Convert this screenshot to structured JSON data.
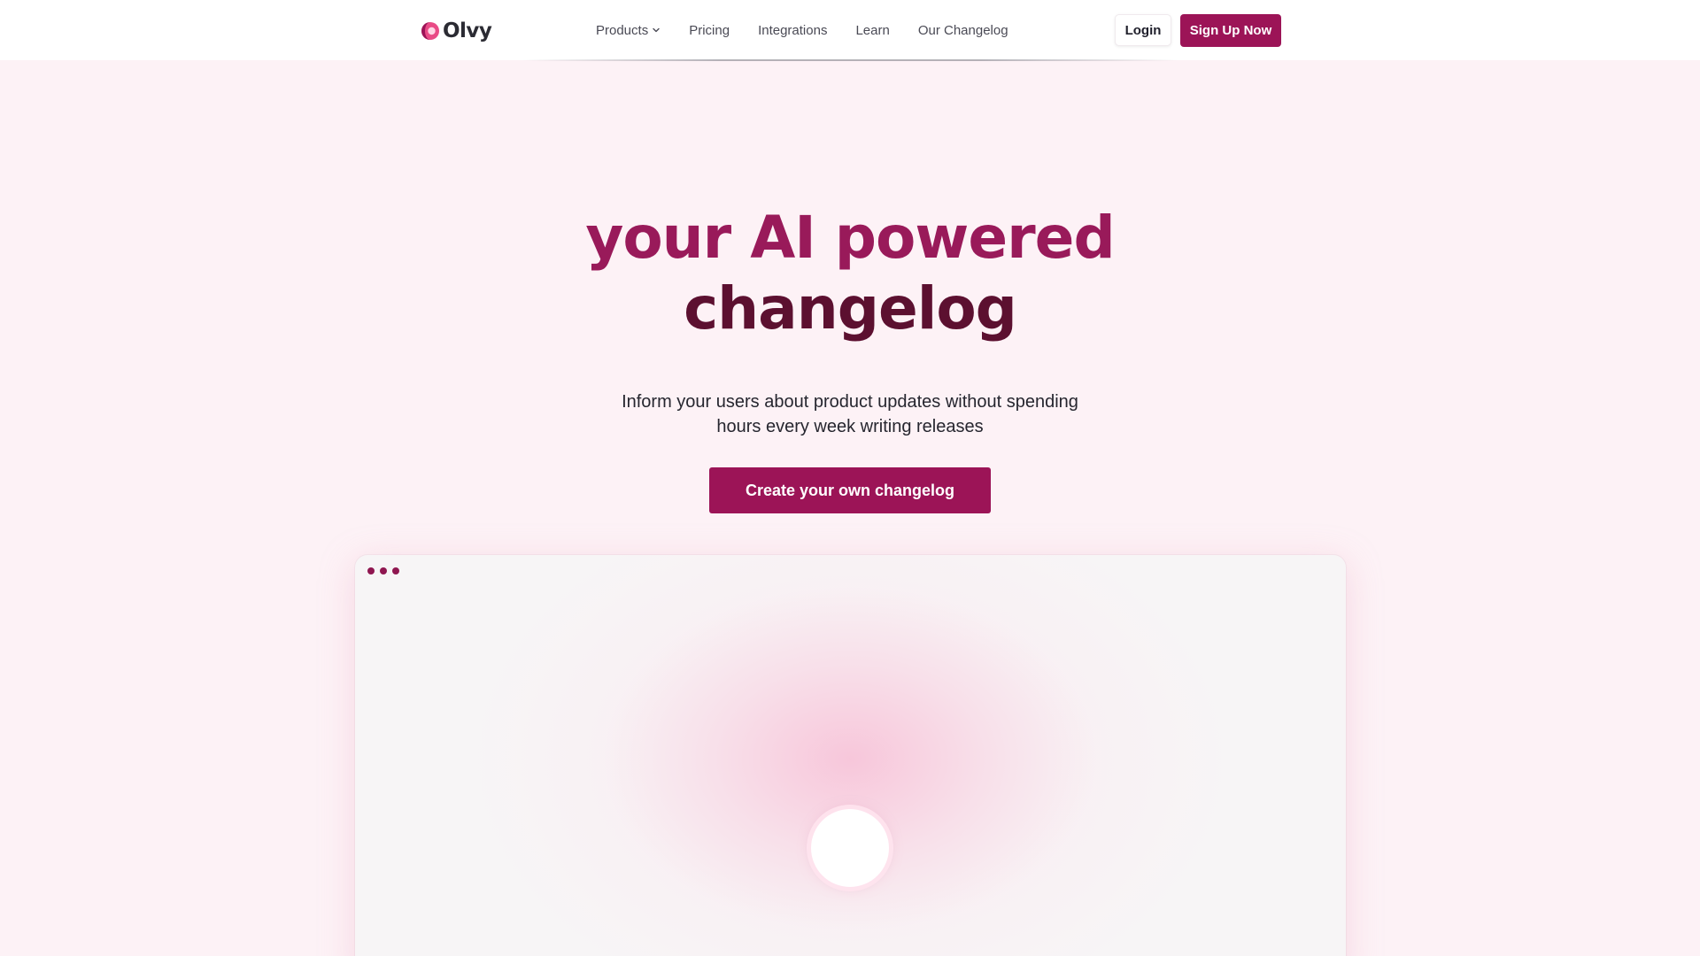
{
  "header": {
    "logo_text": "Olvy",
    "nav": [
      {
        "label": "Products",
        "has_dropdown": true
      },
      {
        "label": "Pricing"
      },
      {
        "label": "Integrations"
      },
      {
        "label": "Learn"
      },
      {
        "label": "Our Changelog"
      }
    ],
    "login_label": "Login",
    "signup_label": "Sign Up Now"
  },
  "hero": {
    "title_line_1": "your AI powered",
    "title_line_2": "changelog",
    "subtitle_line_1": "Inform your users about product updates without spending",
    "subtitle_line_2": "hours every week writing releases",
    "cta_label": "Create your own changelog"
  },
  "icons": {
    "logo": "olvy-logo-icon",
    "dropdown": "chevron-down-icon",
    "window_controls": "window-dots-icon",
    "video": "play-button-icon"
  },
  "colors": {
    "brand": "#9c1457",
    "title_primary": "#991a5a",
    "title_secondary": "#5c1030",
    "page_background": "#fdf2f6"
  }
}
